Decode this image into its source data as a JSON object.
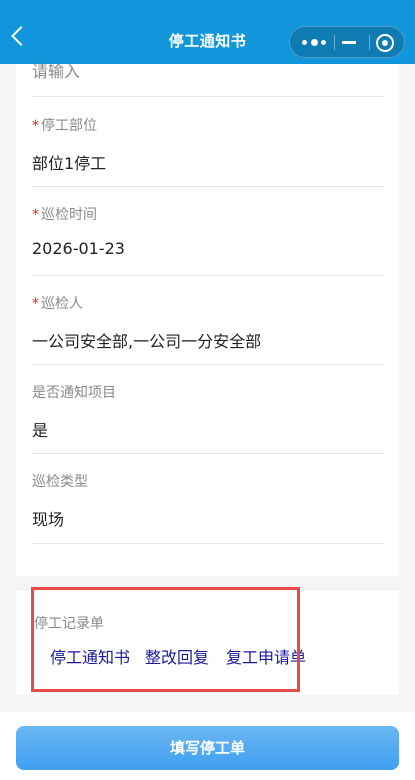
{
  "header": {
    "title": "停工通知书"
  },
  "form": {
    "placeholder_text": "请输入",
    "fields": [
      {
        "label": "停工部位",
        "required": true,
        "value": "部位1停工"
      },
      {
        "label": "巡检时间",
        "required": true,
        "value": "2026-01-23"
      },
      {
        "label": "巡检人",
        "required": true,
        "value": "一公司安全部,一公司一分安全部"
      },
      {
        "label": "是否通知项目",
        "required": false,
        "value": "是"
      },
      {
        "label": "巡检类型",
        "required": false,
        "value": "现场"
      }
    ]
  },
  "records": {
    "label": "停工记录单",
    "links": [
      "停工通知书",
      "整改回复",
      "复工申请单"
    ]
  },
  "footer": {
    "submit_label": "填写停工单"
  },
  "required_mark": "*",
  "colors": {
    "header": "#1296db",
    "link": "#1a1aa0",
    "highlight": "#e84a4a",
    "required": "#e02020"
  }
}
